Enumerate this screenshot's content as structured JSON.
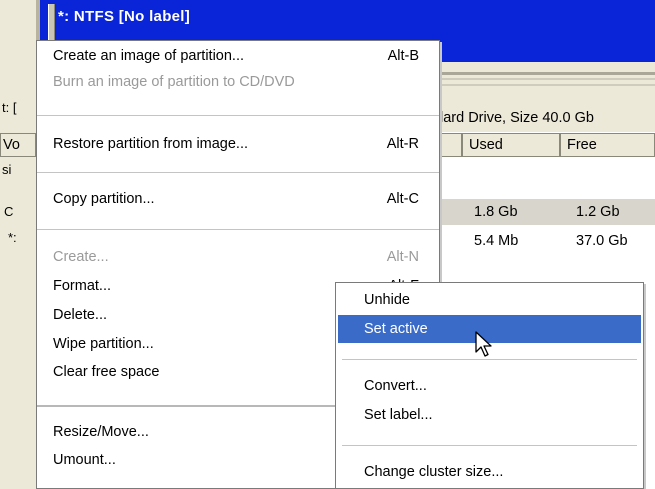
{
  "window": {
    "title": "*: NTFS [No label]"
  },
  "background": {
    "drive_caption": "lard Drive, Size 40.0 Gb",
    "columns": {
      "volume_fragment": "Vo",
      "used": "Used",
      "free": "Free"
    },
    "left_fragments": [
      "t: [",
      "si",
      "C",
      "*:"
    ],
    "rows": [
      {
        "used": "1.8 Gb",
        "free": "1.2 Gb",
        "selected": true
      },
      {
        "used": "5.4 Mb",
        "free": "37.0 Gb",
        "selected": false
      }
    ]
  },
  "menu": {
    "create_image": {
      "label": "Create an image of partition...",
      "shortcut": "Alt-B"
    },
    "burn_image": {
      "label": "Burn an image of partition to CD/DVD"
    },
    "restore": {
      "label": "Restore partition from image...",
      "shortcut": "Alt-R"
    },
    "copy": {
      "label": "Copy partition...",
      "shortcut": "Alt-C"
    },
    "create": {
      "label": "Create...",
      "shortcut": "Alt-N"
    },
    "format": {
      "label": "Format...",
      "shortcut": "Alt-F"
    },
    "delete": {
      "label": "Delete..."
    },
    "wipe": {
      "label": "Wipe partition..."
    },
    "clear_free": {
      "label": "Clear free space"
    },
    "resize_move": {
      "label": "Resize/Move..."
    },
    "umount": {
      "label": "Umount..."
    }
  },
  "submenu": {
    "unhide": "Unhide",
    "set_active": "Set active",
    "convert": "Convert...",
    "set_label": "Set label...",
    "change_cluster": "Change cluster size..."
  },
  "colors": {
    "titlebar": "#0a24d8",
    "highlight": "#3a6bc8",
    "disabled_text": "#9a9a9a"
  }
}
